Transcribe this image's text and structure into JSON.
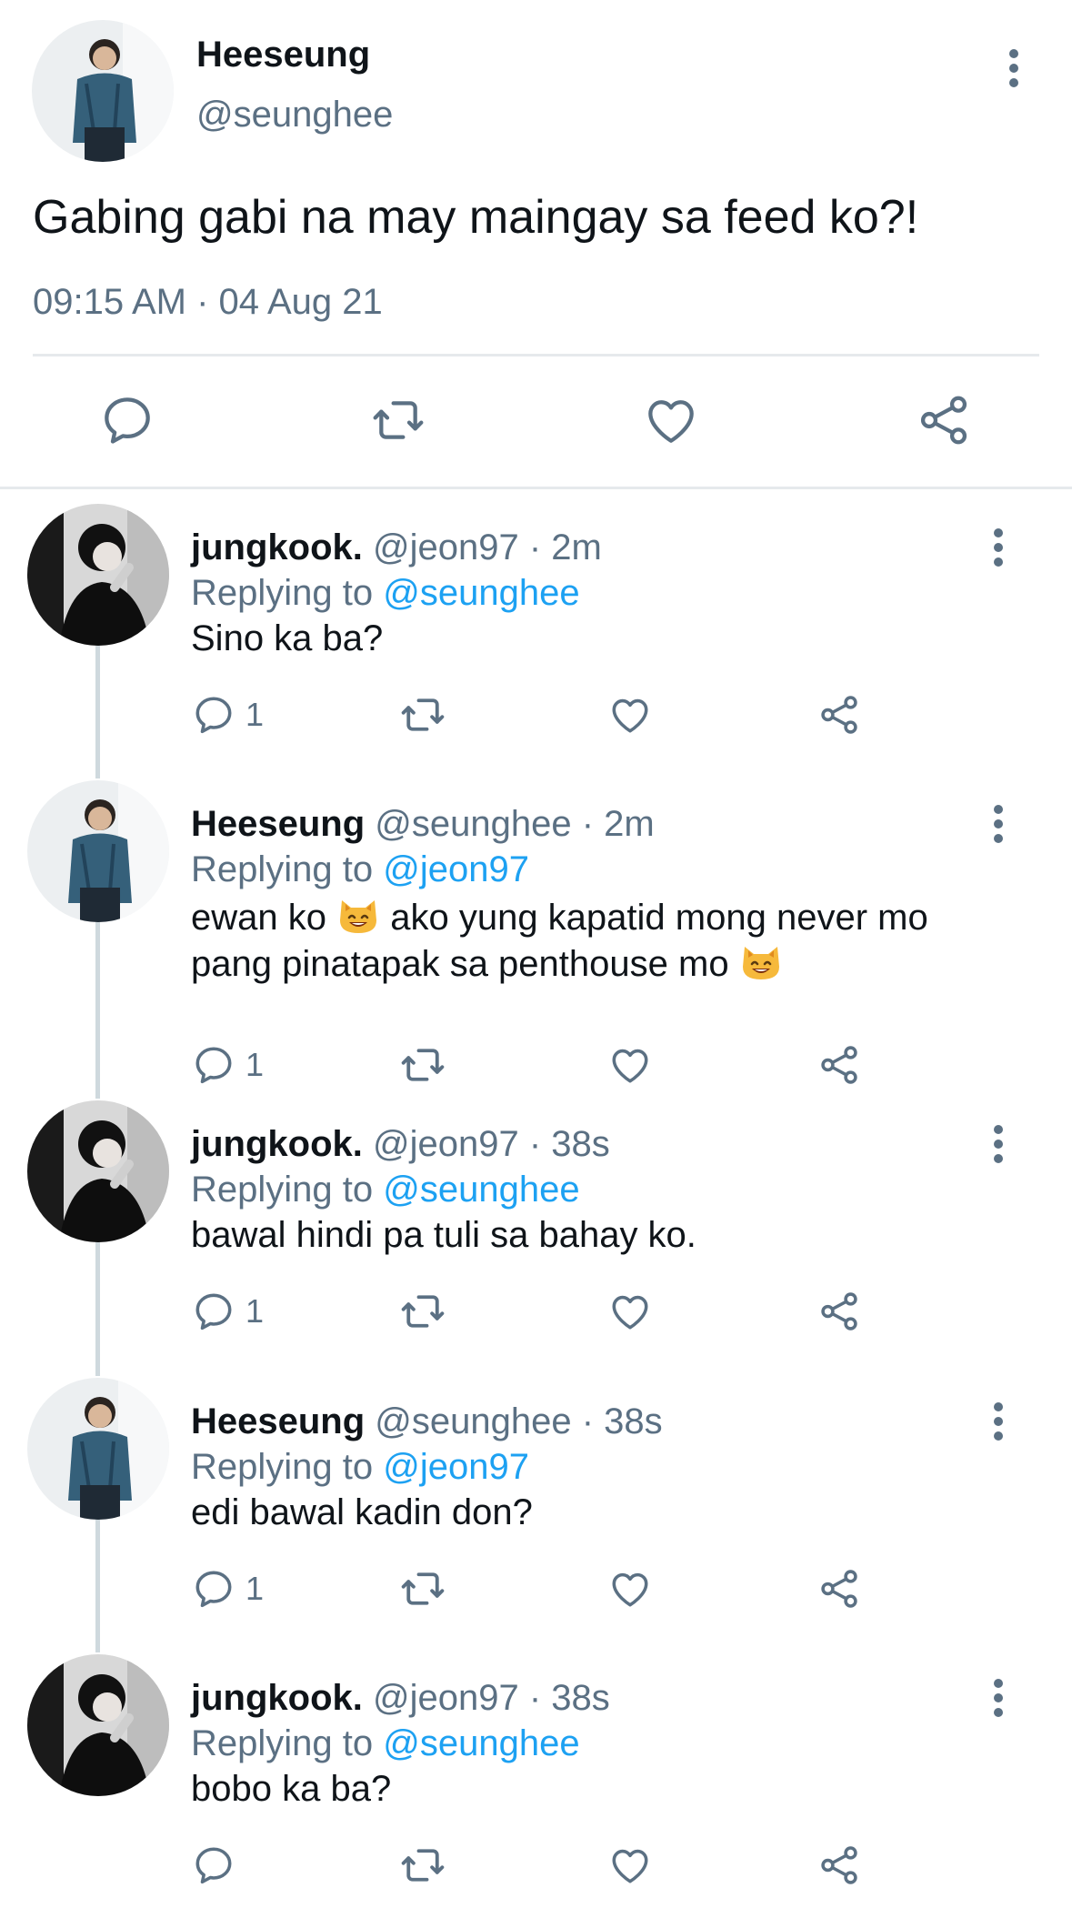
{
  "main_tweet": {
    "name": "Heeseung",
    "handle": "@seunghee",
    "text": "Gabing gabi na may maingay sa feed ko?!",
    "timestamp": "09:15 AM · 04 Aug 21"
  },
  "replies": [
    {
      "name": "jungkook.",
      "meta": " @jeon97 · 2m",
      "replying_prefix": "Replying to ",
      "replying_to": "@seunghee",
      "text_parts": [
        "Sino ka ba?"
      ],
      "reply_count": "1"
    },
    {
      "name": "Heeseung",
      "meta": " @seunghee · 2m",
      "replying_prefix": "Replying to ",
      "replying_to": "@jeon97",
      "text_parts": [
        "ewan ko ",
        " ako yung kapatid mong never mo pang pinatapak sa penthouse mo "
      ],
      "reply_count": "1"
    },
    {
      "name": "jungkook.",
      "meta": " @jeon97 · 38s",
      "replying_prefix": "Replying to ",
      "replying_to": "@seunghee",
      "text_parts": [
        "bawal hindi pa tuli sa bahay ko."
      ],
      "reply_count": "1"
    },
    {
      "name": "Heeseung",
      "meta": " @seunghee · 38s",
      "replying_prefix": "Replying to ",
      "replying_to": "@jeon97",
      "text_parts": [
        "edi bawal kadin don?"
      ],
      "reply_count": "1"
    },
    {
      "name": "jungkook.",
      "meta": " @jeon97 · 38s",
      "replying_prefix": "Replying to ",
      "replying_to": "@seunghee",
      "text_parts": [
        "bobo ka ba?"
      ],
      "reply_count": ""
    }
  ],
  "colors": {
    "accent": "#1da1f2",
    "secondary_text": "#5b7083",
    "thread_line": "#cfd9de"
  },
  "icons": [
    "more-vertical-icon",
    "reply-icon",
    "retweet-icon",
    "like-icon",
    "share-icon",
    "smiling-cat-emoji"
  ]
}
